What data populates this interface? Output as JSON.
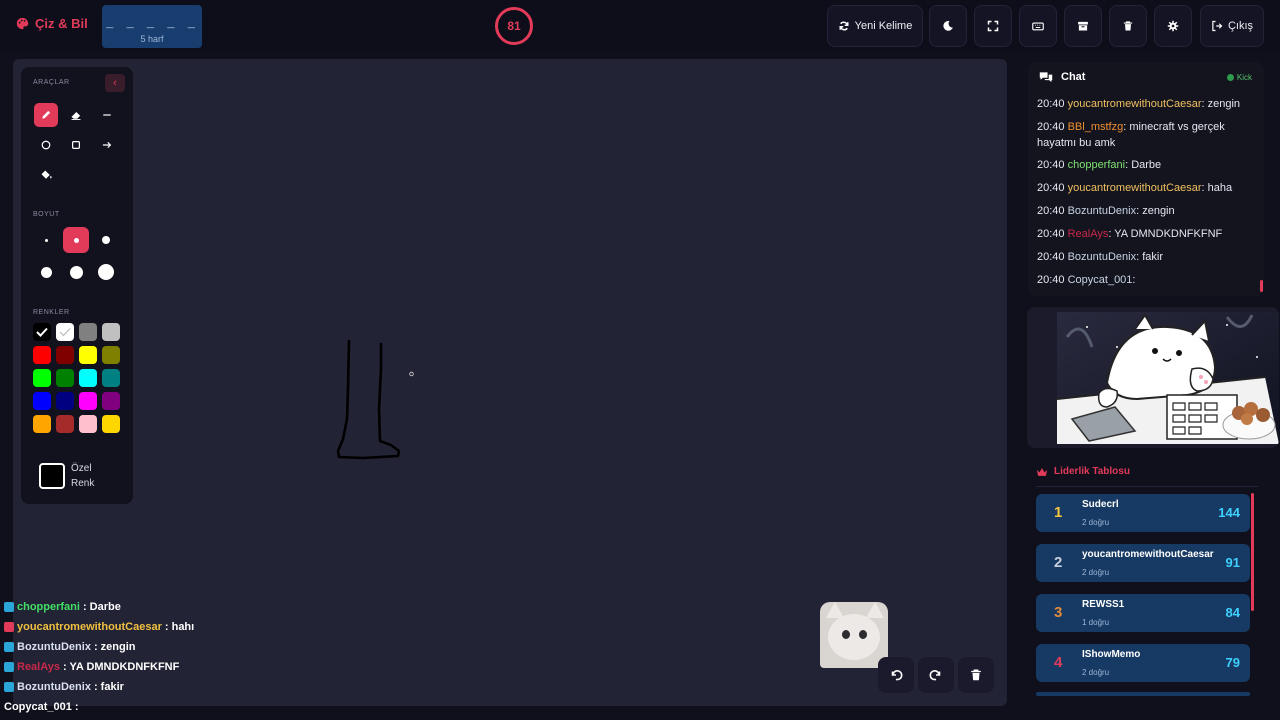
{
  "app": {
    "title": "Çiz & Bil",
    "accent": "#e23b5a"
  },
  "word": {
    "blanks": "_ _ _ _ _",
    "hint": "5 harf"
  },
  "timer": {
    "value": "81"
  },
  "toolbar": {
    "new_word": "Yeni Kelime",
    "exit": "Çıkış",
    "icons": [
      "moon-icon",
      "fullscreen-icon",
      "keyboard-icon",
      "archive-icon",
      "trash-icon",
      "gear-icon"
    ]
  },
  "tools_panel": {
    "tools_label": "ARAÇLAR",
    "size_label": "BOYUT",
    "colors_label": "RENKLER",
    "custom_color_line1": "Özel",
    "custom_color_line2": "Renk",
    "tools": [
      "pencil",
      "eraser",
      "line",
      "circle",
      "rectangle",
      "arrow",
      "fill"
    ],
    "active_tool": "pencil",
    "sizes": [
      "xs",
      "s",
      "m",
      "l",
      "xl",
      "xxl"
    ],
    "active_size": "s",
    "colors": [
      "#000000",
      "#ffffff",
      "#808080",
      "#c0c0c0",
      "#ff0000",
      "#800000",
      "#ffff00",
      "#808000",
      "#00ff00",
      "#008000",
      "#00ffff",
      "#008080",
      "#0000ff",
      "#000080",
      "#ff00ff",
      "#800080",
      "#ffa500",
      "#a52a2a",
      "#ffc0cb",
      "#ffd700"
    ],
    "selected_color": "#000000"
  },
  "overlay_chat": [
    {
      "user": "chopperfani",
      "text": ": Darbe",
      "color": "#41e064"
    },
    {
      "user": "youcantromewithoutCaesar",
      "text": ": hahı",
      "color": "#f0c040"
    },
    {
      "user": "BozuntuDenix",
      "text": ": zengin",
      "color": "#d8e0ec"
    },
    {
      "user": "RealAys",
      "text": ": YA DMNDKDNFKFNF",
      "color": "#c8284a"
    },
    {
      "user": "BozuntuDenix",
      "text": ": fakir",
      "color": "#d8e0ec"
    },
    {
      "user": "Copycat_001",
      "text": ":",
      "color": "#ffffff"
    }
  ],
  "chat": {
    "title": "Chat",
    "platform": "Kick",
    "messages": [
      {
        "time": "20:40",
        "user": "youcantromewithoutCaesar",
        "text": ": zengin",
        "color": "#f0c060"
      },
      {
        "time": "20:40",
        "user": "BBl_mstfzg",
        "text": ": minecraft vs gerçek hayatmı bu amk",
        "color": "#f09030"
      },
      {
        "time": "20:40",
        "user": "chopperfani",
        "text": ": Darbe",
        "color": "#7ee070"
      },
      {
        "time": "20:40",
        "user": "youcantromewithoutCaesar",
        "text": ": haha",
        "color": "#f0c060"
      },
      {
        "time": "20:40",
        "user": "BozuntuDenix",
        "text": ": zengin",
        "color": "#c8d4e4"
      },
      {
        "time": "20:40",
        "user": "RealAys",
        "text": ": YA DMNDKDNFKFNF",
        "color": "#c8284a"
      },
      {
        "time": "20:40",
        "user": "BozuntuDenix",
        "text": ": fakir",
        "color": "#c8d4e4"
      },
      {
        "time": "20:40",
        "user": "Copycat_001",
        "text": ":",
        "color": "#c8d4e4"
      }
    ]
  },
  "leaderboard": {
    "title": "Liderlik Tablosu",
    "rows": [
      {
        "rank": "1",
        "name": "Sudecrl",
        "sub": "2 doğru",
        "score": "144",
        "rank_color": "#f5c542"
      },
      {
        "rank": "2",
        "name": "youcantromewithoutCaesar",
        "sub": "2 doğru",
        "score": "91",
        "rank_color": "#c8d0dc"
      },
      {
        "rank": "3",
        "name": "REWSS1",
        "sub": "1 doğru",
        "score": "84",
        "rank_color": "#e08a3c"
      },
      {
        "rank": "4",
        "name": "IShowMemo",
        "sub": "2 doğru",
        "score": "79",
        "rank_color": "#e23b5a"
      }
    ]
  }
}
